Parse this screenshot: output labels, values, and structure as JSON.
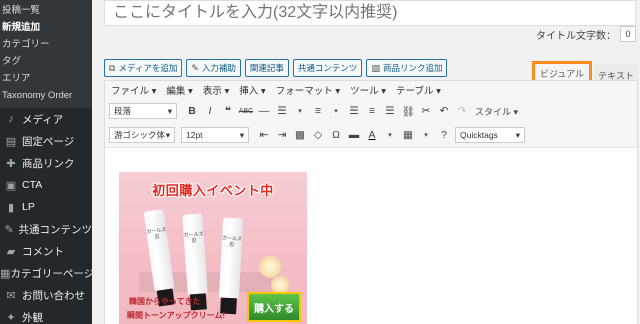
{
  "sidebar": {
    "submenu": [
      {
        "label": "投稿一覧",
        "current": false
      },
      {
        "label": "新規追加",
        "current": true
      },
      {
        "label": "カテゴリー",
        "current": false
      },
      {
        "label": "タグ",
        "current": false
      },
      {
        "label": "エリア",
        "current": false
      },
      {
        "label": "Taxonomy Order",
        "current": false
      }
    ],
    "menu": [
      {
        "label": "メディア",
        "icon": "media-icon"
      },
      {
        "label": "固定ページ",
        "icon": "page-icon"
      },
      {
        "label": "商品リンク",
        "icon": "cart-icon"
      },
      {
        "label": "CTA",
        "icon": "cta-icon"
      },
      {
        "label": "LP",
        "icon": "lp-icon"
      },
      {
        "label": "共通コンテンツ",
        "icon": "content-icon"
      },
      {
        "label": "コメント",
        "icon": "comment-icon"
      },
      {
        "label": "カテゴリーページ",
        "icon": "category-page-icon"
      },
      {
        "label": "お問い合わせ",
        "icon": "mail-icon"
      },
      {
        "label": "外観",
        "icon": "appearance-icon"
      }
    ]
  },
  "editor": {
    "title_placeholder": "ここにタイトルを入力(32文字以内推奨)",
    "title_value": "",
    "title_count_label": "タイトル文字数：",
    "title_count": "0",
    "media_buttons": [
      {
        "label": "メディアを追加",
        "icon": "media-add-icon"
      },
      {
        "label": "入力補助",
        "icon": "pencil-icon"
      },
      {
        "label": "関連記事",
        "icon": ""
      },
      {
        "label": "共通コンテンツ",
        "icon": ""
      },
      {
        "label": "商品リンク追加",
        "icon": "image-icon"
      }
    ],
    "tabs": {
      "visual": "ビジュアル",
      "text": "テキスト"
    },
    "menubar": [
      "ファイル ▾",
      "編集 ▾",
      "表示 ▾",
      "挿入 ▾",
      "フォーマット ▾",
      "ツール ▾",
      "テーブル ▾"
    ],
    "toolbar1": {
      "block_format": "段落",
      "style_label": "スタイル ▾"
    },
    "toolbar2": {
      "font_family": "游ゴシック体",
      "font_size": "12pt",
      "quicktags": "Quicktags"
    },
    "banner": {
      "headline": "初回購入イベント中",
      "line1": "韓国からやってきた",
      "line2": "瞬間トーンアップクリーム!",
      "buy_button": "購入する",
      "tube_label": "ガールズ 忍",
      "colors": {
        "headline": "#e8281f",
        "background": "#f4bcc6",
        "button": "#2e8a2a"
      }
    }
  },
  "colors": {
    "sidebar_bg": "#23282d",
    "highlight": "#ff8a1d",
    "accent": "#2271b1"
  }
}
